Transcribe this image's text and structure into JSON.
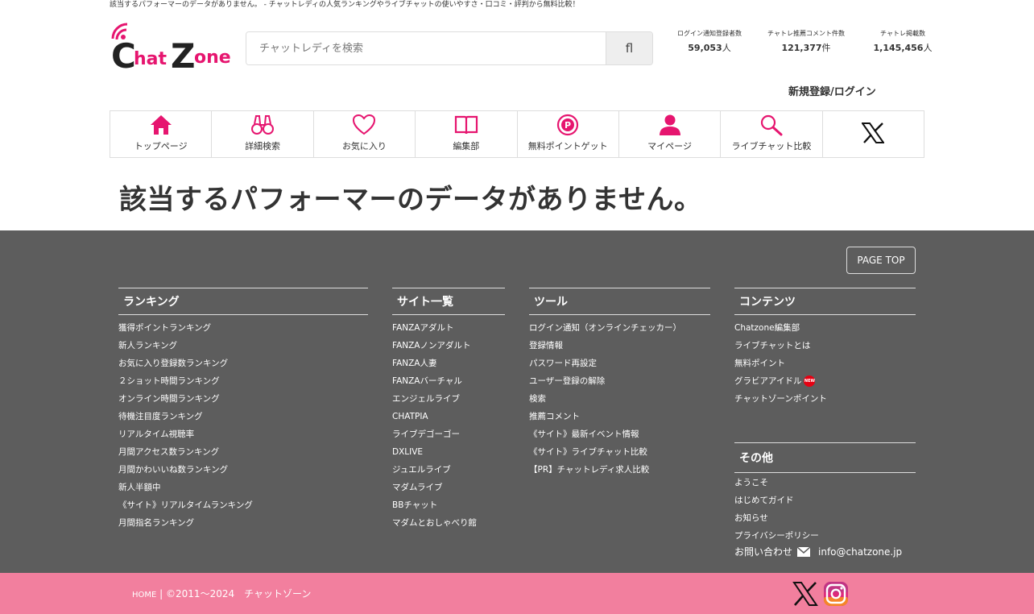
{
  "top_notice": "該当するパフォーマーのデータがありません。 - チャットレディの人気ランキングやライブチャットの使いやすさ・口コミ・評判から無料比較！",
  "logo_text": "ChatZone",
  "search": {
    "placeholder": "チャットレディを検索",
    "button": "fl"
  },
  "stats": [
    {
      "label": "ログイン通知登録者数",
      "value": "59,053",
      "unit": "人"
    },
    {
      "label": "チャトレ推薦コメント件数",
      "value": "121,377",
      "unit": "件"
    },
    {
      "label": "チャトレ掲載数",
      "value": "1,145,456",
      "unit": "人"
    }
  ],
  "login_label": "新規登録/ログイン",
  "nav": [
    {
      "label": "トップページ",
      "icon": "home-icon"
    },
    {
      "label": "詳細検索",
      "icon": "binoculars-icon"
    },
    {
      "label": "お気に入り",
      "icon": "heart-icon"
    },
    {
      "label": "編集部",
      "icon": "book-icon"
    },
    {
      "label": "無料ポイントゲット",
      "icon": "point-icon"
    },
    {
      "label": "マイページ",
      "icon": "user-icon"
    },
    {
      "label": "ライブチャット比較",
      "icon": "magnifier-icon"
    },
    {
      "label": "",
      "icon": "x-icon"
    }
  ],
  "headline": "該当するパフォーマーのデータがありません。",
  "page_top": "PAGE TOP",
  "footer": {
    "ranking": {
      "title": "ランキング",
      "items": [
        "獲得ポイントランキング",
        "新人ランキング",
        "お気に入り登録数ランキング",
        "２ショット時間ランキング",
        "オンライン時間ランキング",
        "待機注目度ランキング",
        "リアルタイム視聴率",
        "月間アクセス数ランキング",
        "月間かわいいね数ランキング",
        "新人半額中",
        "《サイト》リアルタイムランキング",
        "月間指名ランキング"
      ]
    },
    "sites": {
      "title": "サイト一覧",
      "items": [
        "FANZAアダルト",
        "FANZAノンアダルト",
        "FANZA人妻",
        "FANZAバーチャル",
        "エンジェルライブ",
        "CHATPIA",
        "ライブデゴーゴー",
        "DXLIVE",
        "ジュエルライブ",
        "マダムライブ",
        "BBチャット",
        "マダムとおしゃべり館"
      ]
    },
    "tools": {
      "title": "ツール",
      "items": [
        "ログイン通知（オンラインチェッカー）",
        "登録情報",
        "パスワード再設定",
        "ユーザー登録の解除",
        "検索",
        "推薦コメント",
        "《サイト》最新イベント情報",
        "《サイト》ライブチャット比較",
        "【PR】チャットレディ求人比較"
      ]
    },
    "contents": {
      "title": "コンテンツ",
      "items": [
        "Chatzone編集部",
        "ライブチャットとは",
        "無料ポイント",
        "グラビアアイドル",
        "チャットゾーンポイント"
      ],
      "new_badge": "NEW"
    },
    "other": {
      "title": "その他",
      "items": [
        "ようこそ",
        "はじめてガイド",
        "お知らせ",
        "プライバシーポリシー"
      ]
    },
    "contact_label": "お問い合わせ",
    "contact_email": "info@chatzone.jp"
  },
  "bottom": {
    "home": "HOME",
    "copyright": "©2011〜2024　チャットゾーン"
  },
  "colors": {
    "accent": "#e6156f",
    "footer_bg": "#5d5d5d",
    "bottom_bg": "#f27f9e"
  }
}
